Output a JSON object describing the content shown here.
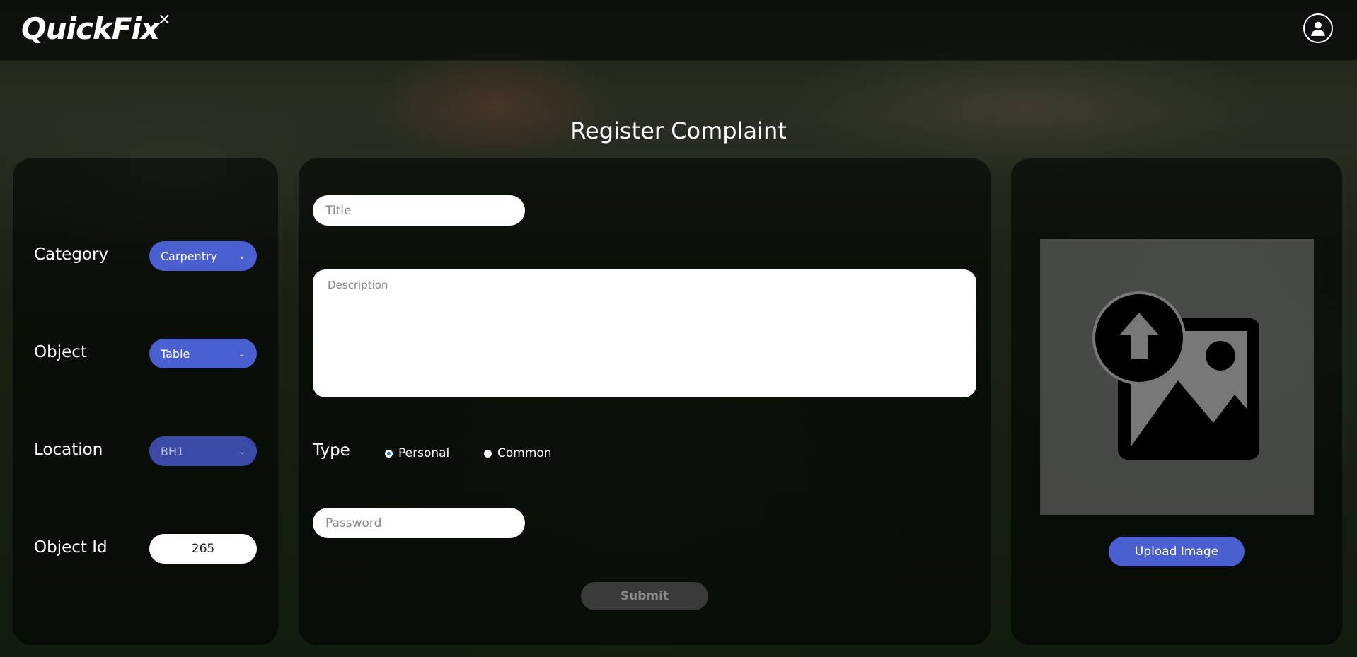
{
  "header": {
    "logo_text": "QuickFix",
    "profile_icon": "user-circle-icon"
  },
  "page": {
    "title": "Register Complaint"
  },
  "left_panel": {
    "category": {
      "label": "Category",
      "value": "Carpentry"
    },
    "object": {
      "label": "Object",
      "value": "Table"
    },
    "location": {
      "label": "Location",
      "value": "BH1"
    },
    "object_id": {
      "label": "Object Id",
      "value": "265"
    }
  },
  "form": {
    "title_placeholder": "Title",
    "description_placeholder": "Description",
    "type_label": "Type",
    "type_options": [
      {
        "label": "Personal",
        "checked": true
      },
      {
        "label": "Common",
        "checked": false
      }
    ],
    "password_placeholder": "Password",
    "submit_label": "Submit"
  },
  "image_panel": {
    "placeholder_icon": "image-upload-icon",
    "upload_label": "Upload Image"
  },
  "colors": {
    "accent": "#4a5fd0",
    "panel_bg": "rgba(0,0,0,0.55)"
  }
}
